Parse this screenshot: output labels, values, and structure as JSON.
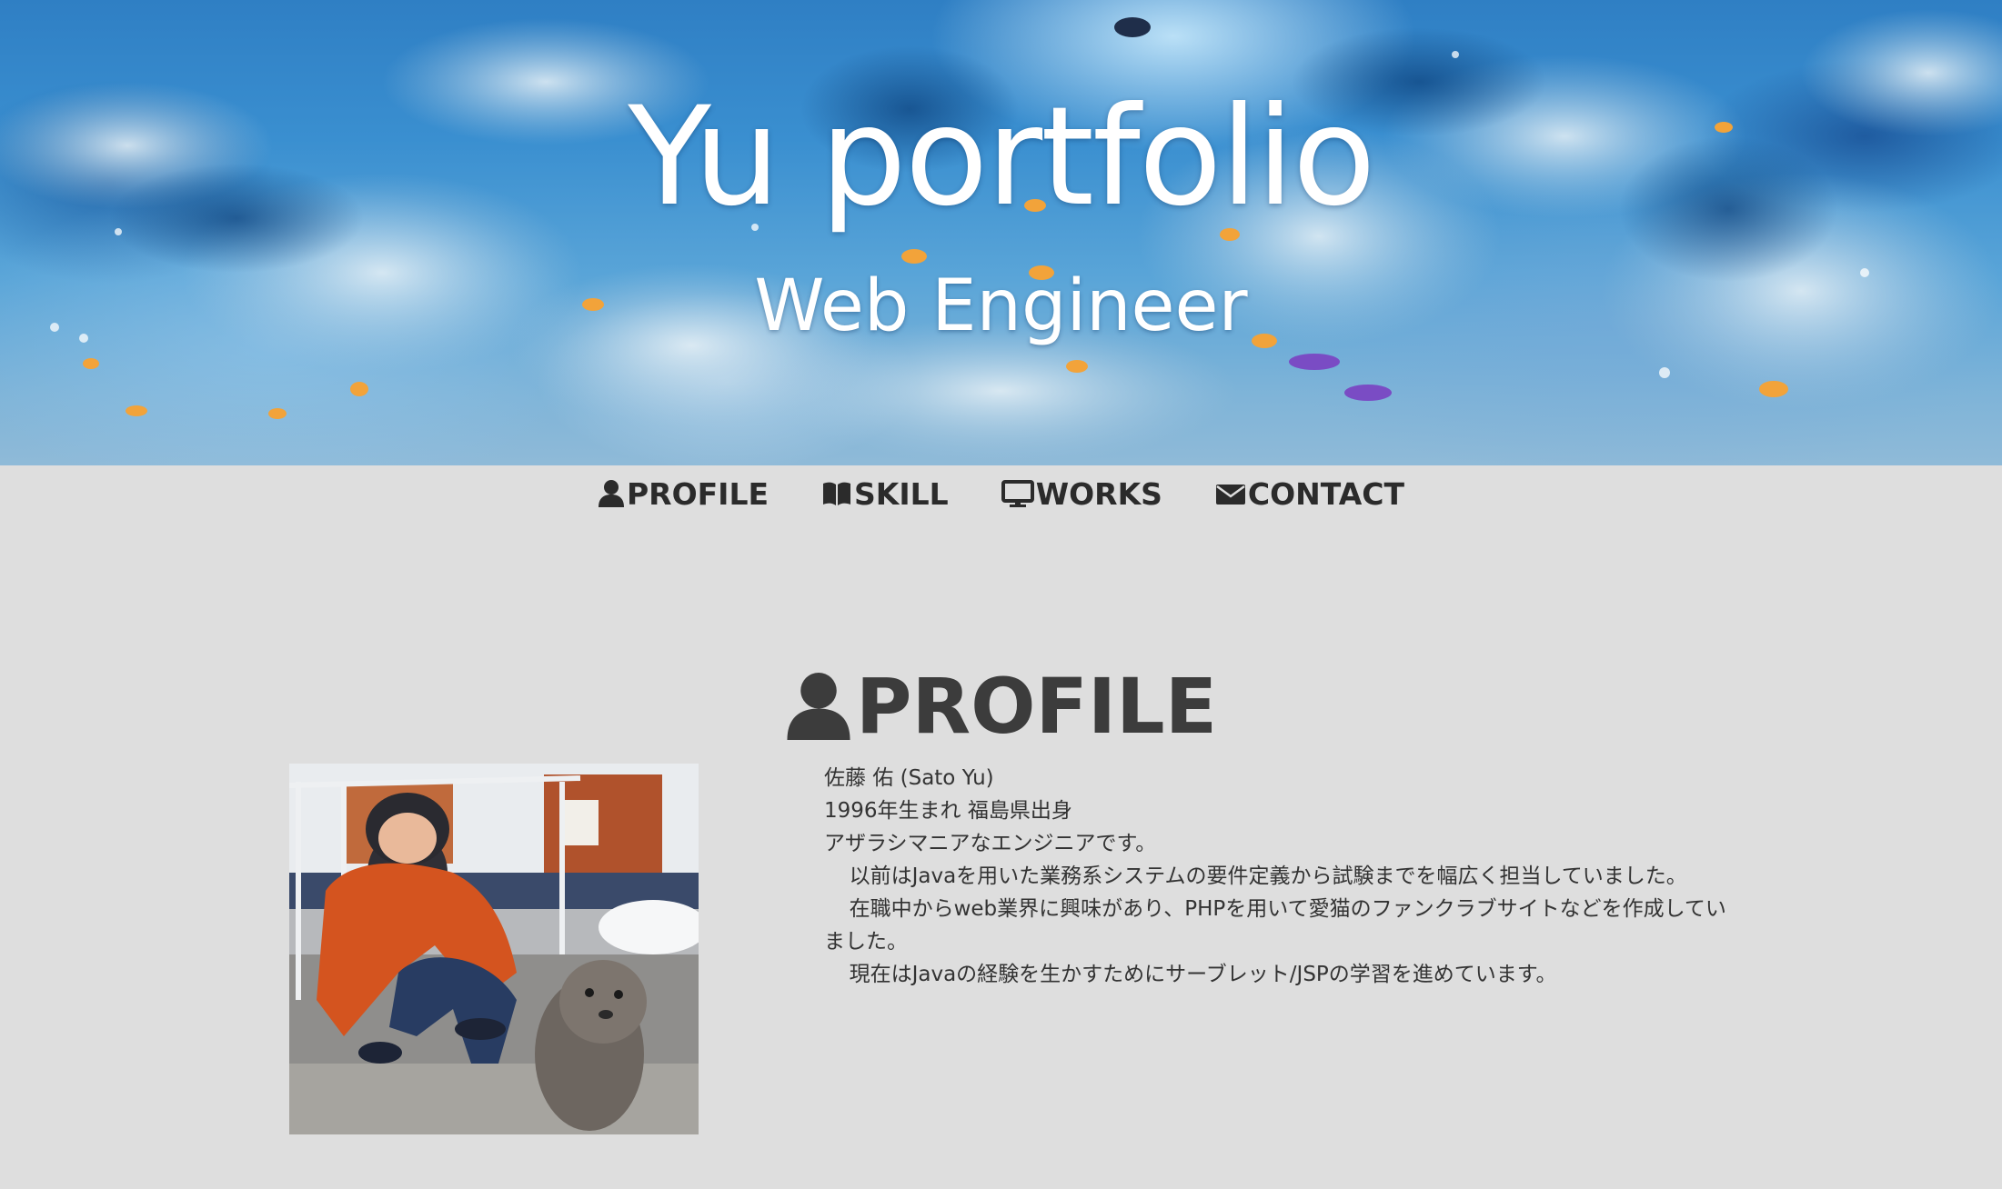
{
  "hero": {
    "title": "Yu portfolio",
    "subtitle": "Web Engineer",
    "background_image": "underwater-coral-reef"
  },
  "nav": {
    "items": [
      {
        "label": "PROFILE",
        "icon": "user-icon"
      },
      {
        "label": "SKILL",
        "icon": "book-icon"
      },
      {
        "label": "WORKS",
        "icon": "monitor-icon"
      },
      {
        "label": "CONTACT",
        "icon": "envelope-icon"
      }
    ]
  },
  "profile": {
    "heading": "PROFILE",
    "heading_icon": "user-icon",
    "photo": "photo-person-with-seal",
    "lines": [
      "佐藤 佑 (Sato Yu)",
      "1996年生まれ 福島県出身",
      "アザラシマニアなエンジニアです。",
      "以前はJavaを用いた業務系システムの要件定義から試験までを幅広く担当していました。",
      "在職中からweb業界に興味があり、PHPを用いて愛猫のファンクラブサイトなどを作成していました。",
      "現在はJavaの経験を生かすためにサーブレット/JSPの学習を進めています。"
    ]
  },
  "colors": {
    "page_background": "#dedede",
    "text_dark": "#2b2b2b",
    "heading": "#3c3c3c",
    "hero_text": "#ffffff"
  }
}
